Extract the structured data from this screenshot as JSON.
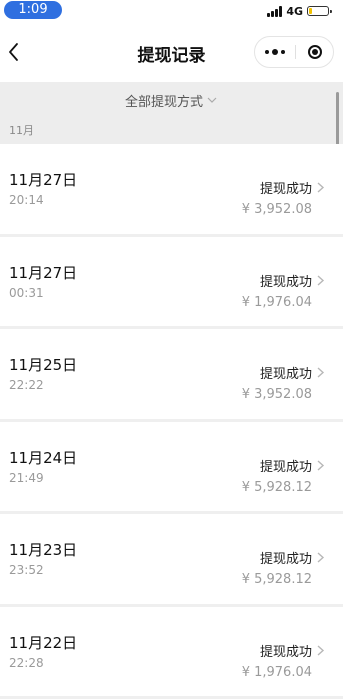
{
  "status_bar": {
    "time": "1:09",
    "network": "4G",
    "battery_level": 0.2
  },
  "nav": {
    "title": "提现记录"
  },
  "filter": {
    "label": "全部提现方式",
    "month": "11月"
  },
  "records": [
    {
      "date": "11月27日",
      "time": "20:14",
      "status": "提现成功",
      "amount": "¥ 3,952.08"
    },
    {
      "date": "11月27日",
      "time": "00:31",
      "status": "提现成功",
      "amount": "¥ 1,976.04"
    },
    {
      "date": "11月25日",
      "time": "22:22",
      "status": "提现成功",
      "amount": "¥ 3,952.08"
    },
    {
      "date": "11月24日",
      "time": "21:49",
      "status": "提现成功",
      "amount": "¥ 5,928.12"
    },
    {
      "date": "11月23日",
      "time": "23:52",
      "status": "提现成功",
      "amount": "¥ 5,928.12"
    },
    {
      "date": "11月22日",
      "time": "22:28",
      "status": "提现成功",
      "amount": "¥ 1,976.04"
    }
  ],
  "colors": {
    "time_pill": "#2f6fe0",
    "battery_level": "#f2c200",
    "filter_background": "#ededed"
  },
  "icons": [
    "back-arrow-icon",
    "more-dots-icon",
    "target-circle-icon",
    "chevron-down-icon",
    "chevron-right-icon",
    "signal-icon",
    "battery-icon"
  ]
}
